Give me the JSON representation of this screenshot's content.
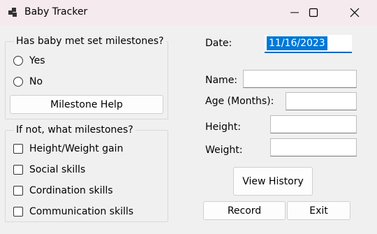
{
  "window": {
    "title": "Baby Tracker",
    "controls": [
      "minimize",
      "maximize",
      "close"
    ]
  },
  "milestones_group": {
    "label": "Has baby met set milestones?",
    "options": [
      "Yes",
      "No"
    ],
    "help_button": "Milestone Help"
  },
  "missing_group": {
    "label": "If not, what milestones?",
    "items": [
      "Height/Weight gain",
      "Social skills",
      "Cordination skills",
      "Communication skills"
    ]
  },
  "form": {
    "date_label": "Date:",
    "date_value": "11/16/2023",
    "name_label": "Name:",
    "name_value": "",
    "age_label": "Age (Months):",
    "age_value": "",
    "height_label": "Height:",
    "height_value": "",
    "weight_label": "Weight:",
    "weight_value": ""
  },
  "buttons": {
    "view_history": "View History",
    "record": "Record",
    "exit": "Exit"
  },
  "colors": {
    "titlebar": "#f5eaed",
    "selection": "#0078d7",
    "focus_underline": "#0067c0"
  }
}
